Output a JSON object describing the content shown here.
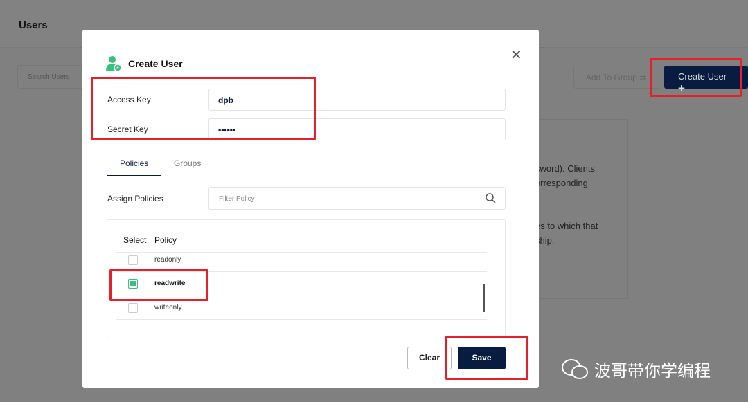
{
  "page": {
    "title": "Users",
    "search_placeholder": "Search Users",
    "add_to_group": "Add To Group",
    "create_user": "Create User",
    "info_lines": [
      "sword). Clients",
      "orresponding",
      "es to which that",
      "ship."
    ]
  },
  "modal": {
    "title": "Create User",
    "access_key_label": "Access Key",
    "access_key_value": "dpb",
    "secret_key_label": "Secret Key",
    "secret_key_value": "••••••",
    "tabs": [
      {
        "label": "Policies",
        "active": true
      },
      {
        "label": "Groups",
        "active": false
      }
    ],
    "assign_label": "Assign Policies",
    "filter_placeholder": "Filter Policy",
    "columns": [
      "Select",
      "Policy"
    ],
    "policies": [
      {
        "name": "readonly",
        "checked": false
      },
      {
        "name": "readwrite",
        "checked": true
      },
      {
        "name": "writeonly",
        "checked": false
      }
    ],
    "clear": "Clear",
    "save": "Save"
  },
  "colors": {
    "accent": "#081c42",
    "check": "#39c07e",
    "highlight": "#e6202a"
  },
  "watermark": "波哥带你学编程"
}
